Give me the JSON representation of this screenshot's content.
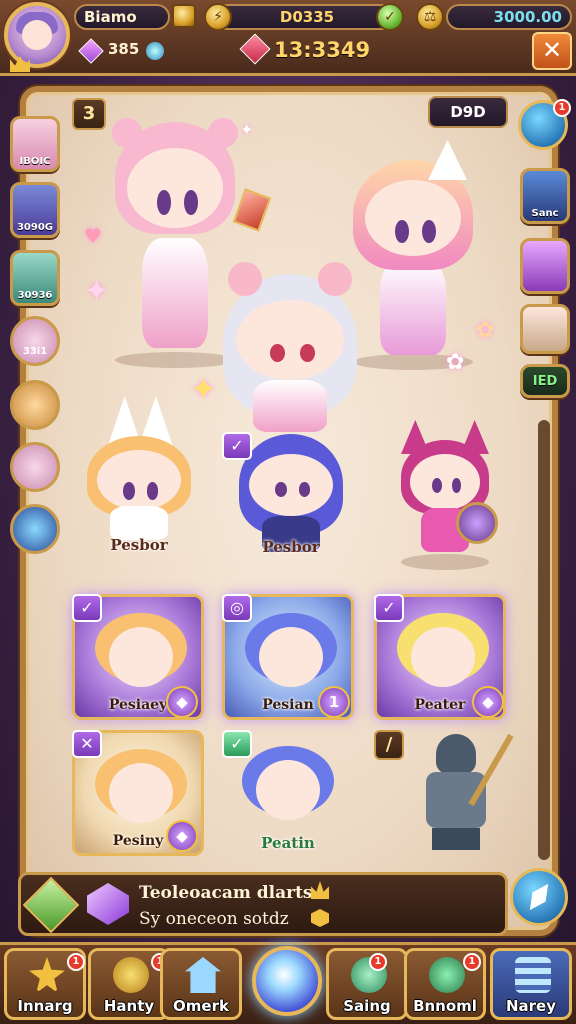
{
  "top": {
    "player_name": "Biamo",
    "gems": "385",
    "gold": "D0335",
    "timer": "13:3349",
    "premium": "3000.00"
  },
  "panel": {
    "page_badge": "3",
    "counter": "D9D",
    "notif_count": "1",
    "left_tabs": [
      "IBOIC",
      "3090G",
      "30936",
      "33i1",
      "",
      "",
      ""
    ],
    "right_tabs": [
      "Sanc",
      "",
      "",
      "IED"
    ]
  },
  "characters": [
    {
      "name": ""
    },
    {
      "name": ""
    },
    {
      "name": ""
    },
    {
      "name": "Pesbor"
    },
    {
      "name": "Pesbor"
    },
    {
      "name": ""
    }
  ],
  "cards": [
    {
      "name": "Pesiaey",
      "rank": "✓",
      "level": ""
    },
    {
      "name": "Pesian",
      "rank": "",
      "level": "1"
    },
    {
      "name": "Peater",
      "rank": "✓",
      "level": ""
    },
    {
      "name": "Pesiny",
      "rank": "✕",
      "level": ""
    },
    {
      "name": "Peatin",
      "rank": "✓",
      "level": ""
    },
    {
      "name": "",
      "rank": "/",
      "level": ""
    }
  ],
  "info": {
    "line1": "Teoleoacam dlarts",
    "line2": "Sy oneceon sotdz"
  },
  "nav": [
    {
      "label": "Innarg",
      "notif": "1"
    },
    {
      "label": "Hanty",
      "notif": "1"
    },
    {
      "label": "Omerk",
      "notif": ""
    },
    {
      "label": "Saing",
      "notif": "1"
    },
    {
      "label": "Bnnoml",
      "notif": "1"
    },
    {
      "label": "Narey",
      "notif": ""
    }
  ],
  "colors": {
    "frame_gold": "#c99a4a",
    "panel_bg": "#f7eadb",
    "accent_purple": "#a878d8",
    "notif_red": "#e83a2a"
  }
}
